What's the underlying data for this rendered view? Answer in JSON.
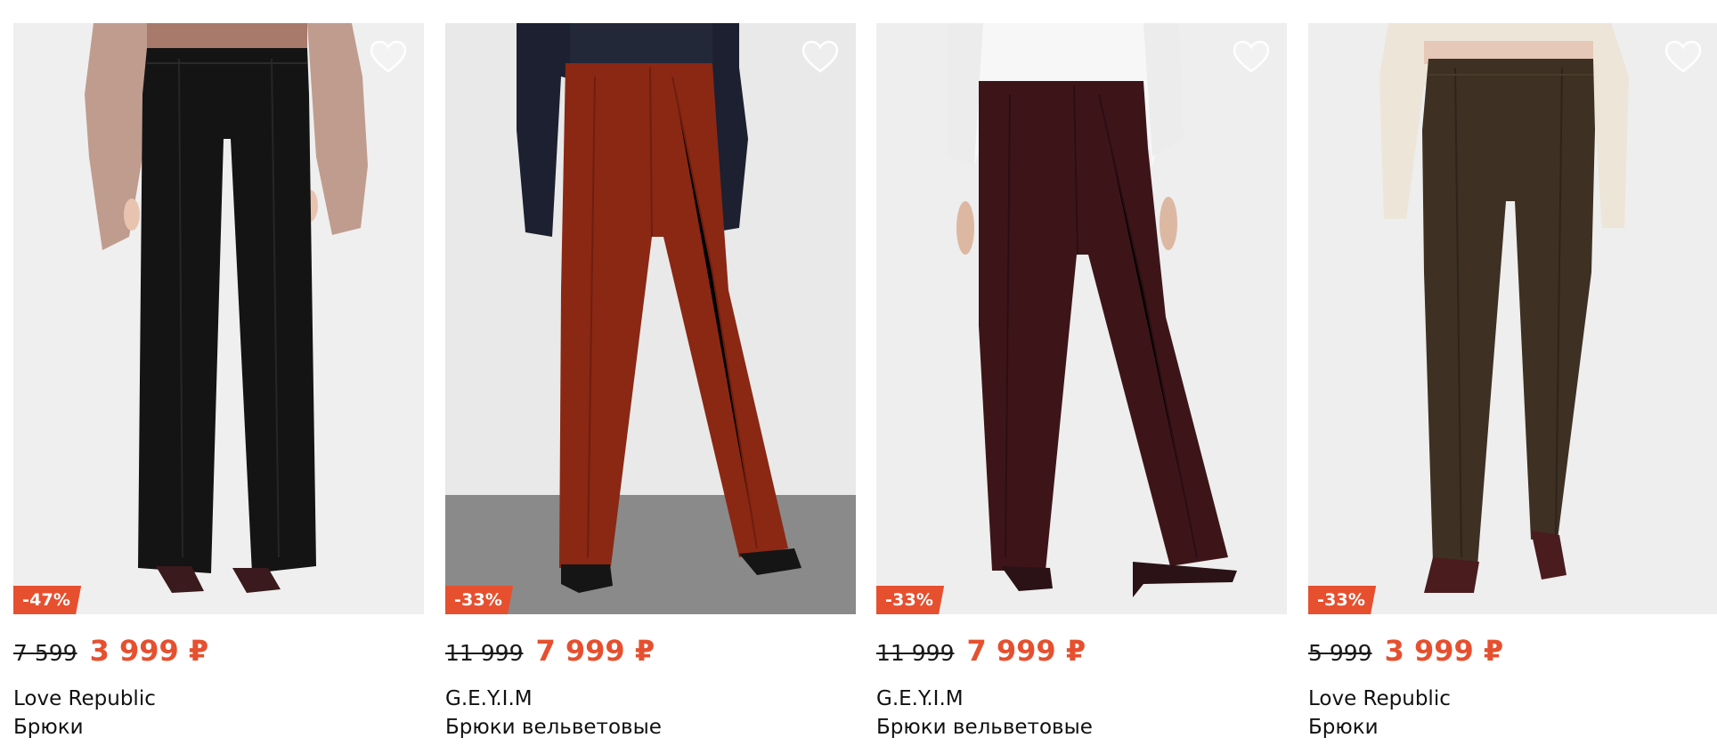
{
  "products": [
    {
      "discount": "-47%",
      "old_price": "7 599",
      "new_price": "3 999 ₽",
      "brand": "Love Republic",
      "name": "Брюки",
      "photo": {
        "background": "#efefef",
        "pants_color": "#141414",
        "top_color": "#b78d7e",
        "shoe_color": "#3a1a1c"
      }
    },
    {
      "discount": "-33%",
      "old_price": "11 999",
      "new_price": "7 999 ₽",
      "brand": "G.E.Y.I.M",
      "name": "Брюки вельветовые",
      "photo": {
        "background": "#e9e9e9",
        "floor_color": "#8a8a8a",
        "pants_color": "#8a2814",
        "top_color": "#1c2030",
        "shoe_color": "#151515"
      }
    },
    {
      "discount": "-33%",
      "old_price": "11 999",
      "new_price": "7 999 ₽",
      "brand": "G.E.Y.I.M",
      "name": "Брюки вельветовые",
      "photo": {
        "background": "#eeeeee",
        "pants_color": "#3d1519",
        "top_color": "#f7f7f7",
        "shoe_color": "#2a1216"
      }
    },
    {
      "discount": "-33%",
      "old_price": "5 999",
      "new_price": "3 999 ₽",
      "brand": "Love Republic",
      "name": "Брюки",
      "photo": {
        "background": "#eeeeee",
        "pants_color": "#3e3023",
        "top_color": "#ece5d8",
        "shoe_color": "#4a1c1e"
      }
    }
  ],
  "colors": {
    "accent": "#e6502f",
    "text": "#111111"
  },
  "icons": {
    "favorite": "heart-outline-icon"
  }
}
